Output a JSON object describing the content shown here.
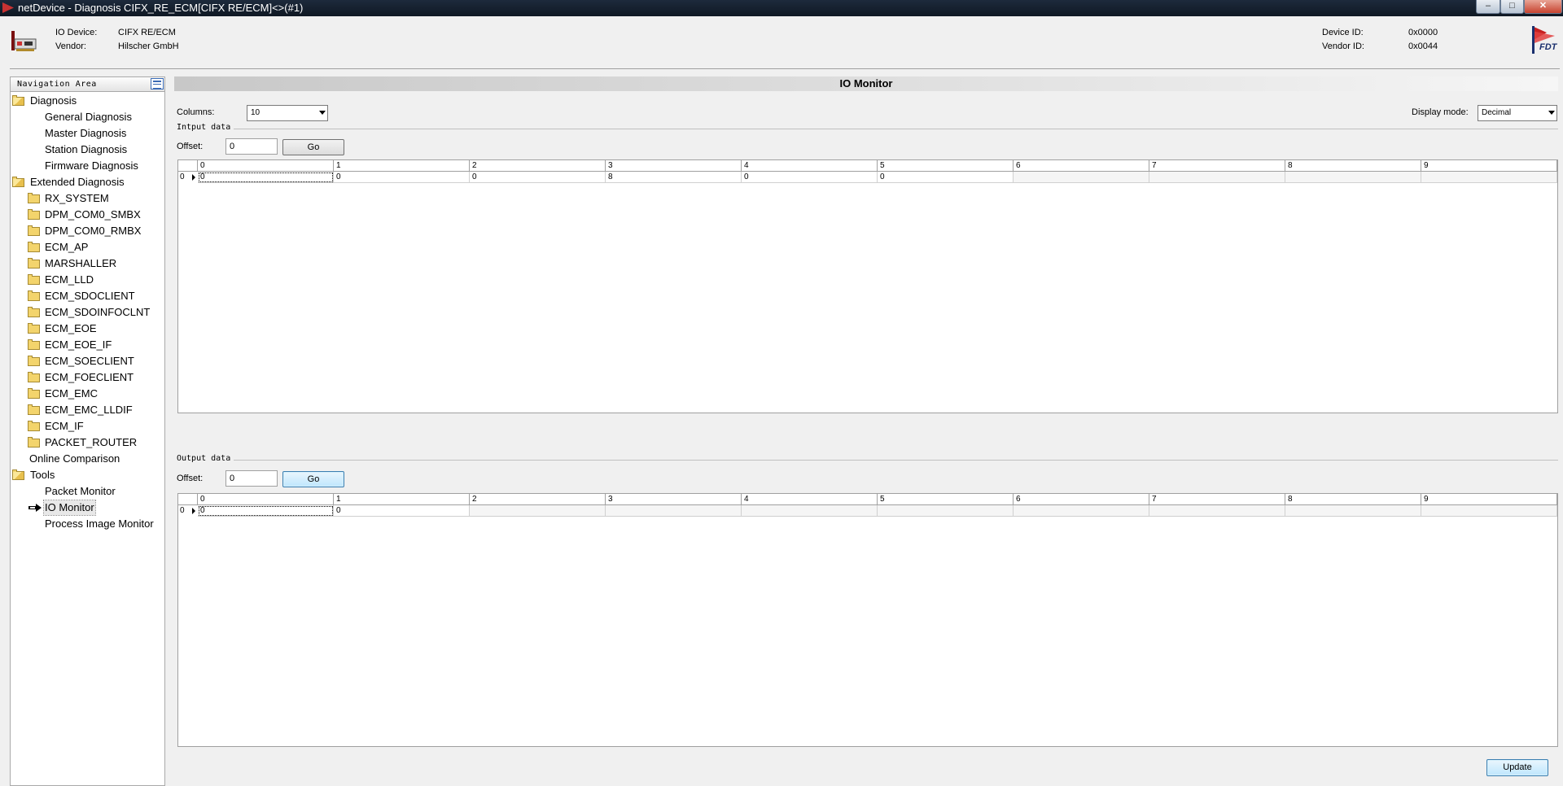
{
  "window": {
    "title": "netDevice - Diagnosis CIFX_RE_ECM[CIFX RE/ECM]<>(#1)",
    "minimize": "–",
    "maximize": "□",
    "close": "✕"
  },
  "header": {
    "io_device_label": "IO Device:",
    "io_device_value": "CIFX RE/ECM",
    "vendor_label": "Vendor:",
    "vendor_value": "Hilscher GmbH",
    "device_id_label": "Device ID:",
    "device_id_value": "0x0000",
    "vendor_id_label": "Vendor ID:",
    "vendor_id_value": "0x0044",
    "logo_text": "FDT"
  },
  "nav": {
    "title": "Navigation Area",
    "diagnosis": "Diagnosis",
    "general_diagnosis": "General Diagnosis",
    "master_diagnosis": "Master Diagnosis",
    "station_diagnosis": "Station Diagnosis",
    "firmware_diagnosis": "Firmware Diagnosis",
    "extended_diagnosis": "Extended Diagnosis",
    "extended_items": [
      "RX_SYSTEM",
      "DPM_COM0_SMBX",
      "DPM_COM0_RMBX",
      "ECM_AP",
      "MARSHALLER",
      "ECM_LLD",
      "ECM_SDOCLIENT",
      "ECM_SDOINFOCLNT",
      "ECM_EOE",
      "ECM_EOE_IF",
      "ECM_SOECLIENT",
      "ECM_FOECLIENT",
      "ECM_EMC",
      "ECM_EMC_LLDIF",
      "ECM_IF",
      "PACKET_ROUTER"
    ],
    "online_comparison": "Online Comparison",
    "tools": "Tools",
    "packet_monitor": "Packet Monitor",
    "io_monitor": "IO Monitor",
    "process_image_monitor": "Process Image Monitor"
  },
  "main": {
    "title": "IO Monitor",
    "columns_label": "Columns:",
    "columns_value": "10",
    "display_mode_label": "Display mode:",
    "display_mode_value": "Decimal",
    "input": {
      "group_label": "Intput data",
      "offset_label": "Offset:",
      "offset_value": "0",
      "go_label": "Go",
      "col_headers": [
        "0",
        "1",
        "2",
        "3",
        "4",
        "5",
        "6",
        "7",
        "8",
        "9"
      ],
      "row_label": "0",
      "values": [
        "0",
        "0",
        "0",
        "8",
        "0",
        "0",
        "",
        "",
        "",
        ""
      ]
    },
    "output": {
      "group_label": "Output data",
      "offset_label": "Offset:",
      "offset_value": "0",
      "go_label": "Go",
      "col_headers": [
        "0",
        "1",
        "2",
        "3",
        "4",
        "5",
        "6",
        "7",
        "8",
        "9"
      ],
      "row_label": "0",
      "values": [
        "0",
        "0",
        "",
        "",
        "",
        "",
        "",
        "",
        "",
        ""
      ]
    },
    "update_label": "Update"
  }
}
